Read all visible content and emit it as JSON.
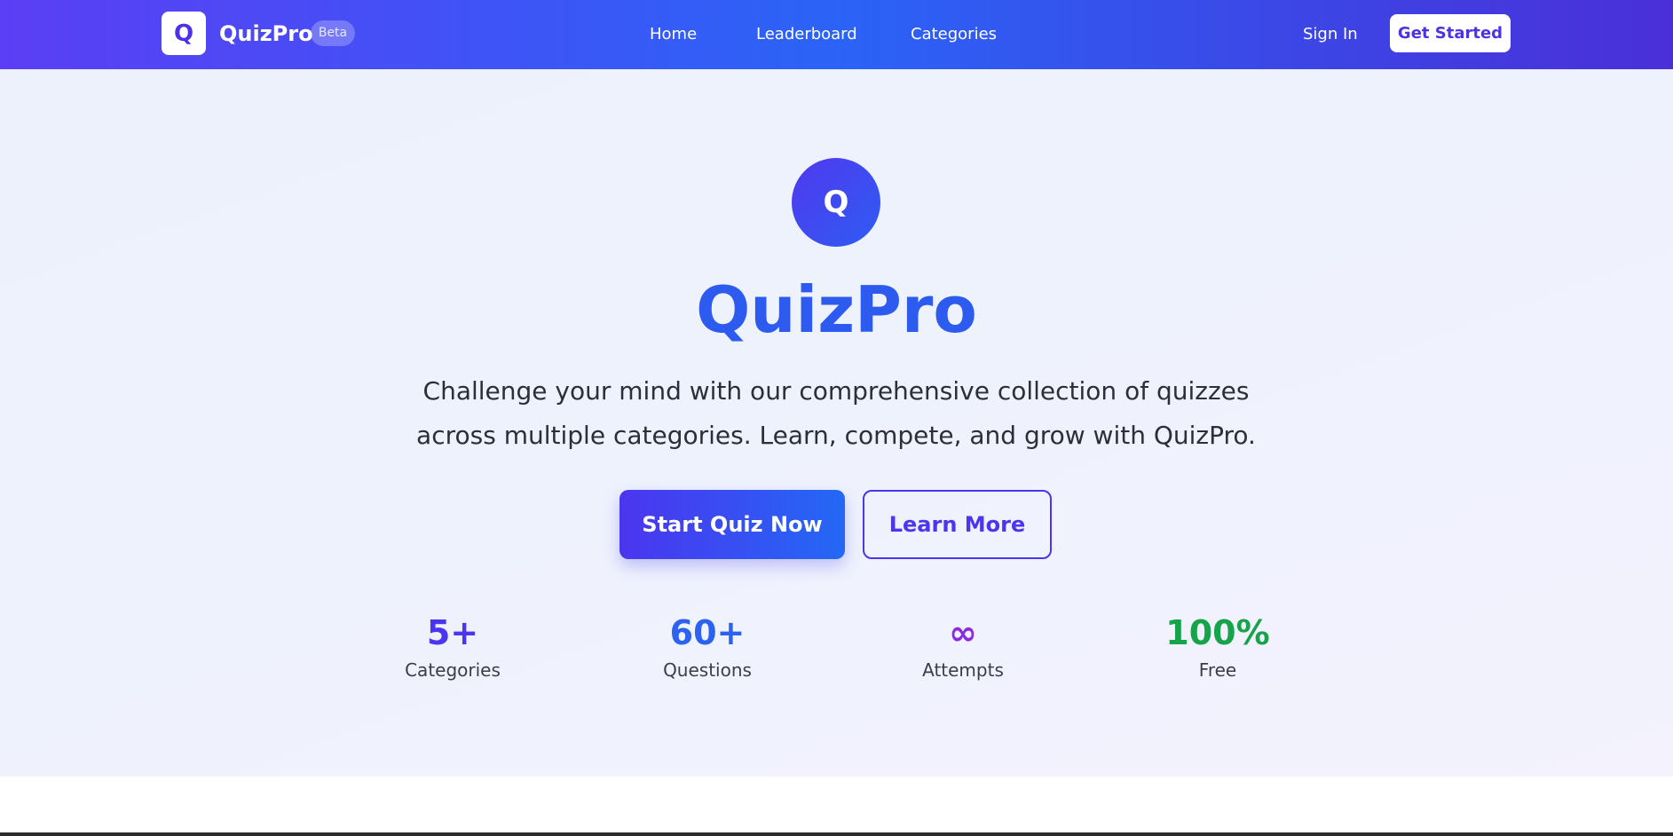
{
  "nav": {
    "logo_letter": "Q",
    "brand": "QuizPro",
    "badge": "Beta",
    "links": [
      "Home",
      "Leaderboard",
      "Categories"
    ],
    "signin": "Sign In",
    "cta": "Get Started"
  },
  "hero": {
    "icon_letter": "Q",
    "title": "QuizPro",
    "subtitle": "Challenge your mind with our comprehensive collection of quizzes across multiple categories. Learn, compete, and grow with QuizPro.",
    "primary_button": "Start Quiz Now",
    "secondary_button": "Learn More"
  },
  "stats": [
    {
      "value": "5+",
      "label": "Categories",
      "color": "#4b35ef"
    },
    {
      "value": "60+",
      "label": "Questions",
      "color": "#2b63f0"
    },
    {
      "value": "∞",
      "label": "Attempts",
      "color": "#8a2be2"
    },
    {
      "value": "100%",
      "label": "Free",
      "color": "#16a34a"
    }
  ],
  "colors": {
    "brand_primary": "#4b35ef",
    "brand_secondary": "#2b63f6"
  }
}
